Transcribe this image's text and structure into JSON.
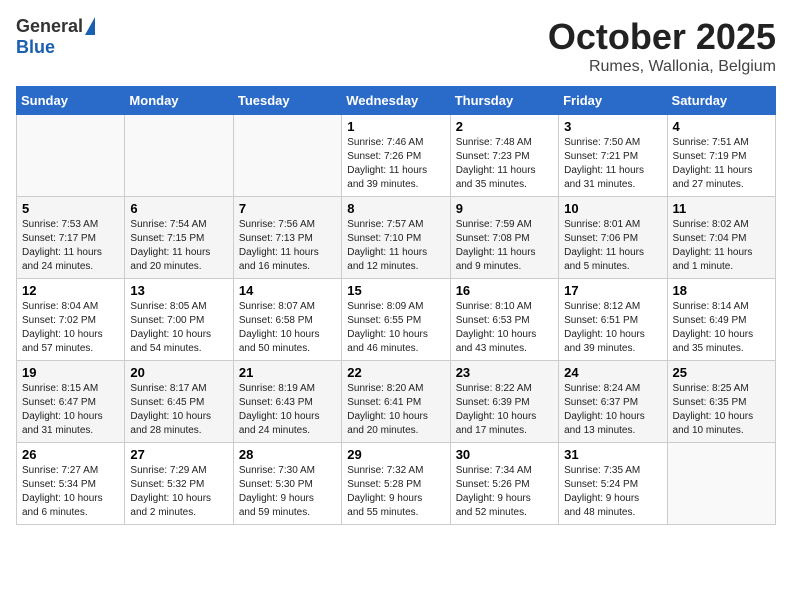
{
  "logo": {
    "general": "General",
    "blue": "Blue"
  },
  "title": "October 2025",
  "location": "Rumes, Wallonia, Belgium",
  "days_of_week": [
    "Sunday",
    "Monday",
    "Tuesday",
    "Wednesday",
    "Thursday",
    "Friday",
    "Saturday"
  ],
  "weeks": [
    [
      {
        "day": "",
        "content": ""
      },
      {
        "day": "",
        "content": ""
      },
      {
        "day": "",
        "content": ""
      },
      {
        "day": "1",
        "content": "Sunrise: 7:46 AM\nSunset: 7:26 PM\nDaylight: 11 hours\nand 39 minutes."
      },
      {
        "day": "2",
        "content": "Sunrise: 7:48 AM\nSunset: 7:23 PM\nDaylight: 11 hours\nand 35 minutes."
      },
      {
        "day": "3",
        "content": "Sunrise: 7:50 AM\nSunset: 7:21 PM\nDaylight: 11 hours\nand 31 minutes."
      },
      {
        "day": "4",
        "content": "Sunrise: 7:51 AM\nSunset: 7:19 PM\nDaylight: 11 hours\nand 27 minutes."
      }
    ],
    [
      {
        "day": "5",
        "content": "Sunrise: 7:53 AM\nSunset: 7:17 PM\nDaylight: 11 hours\nand 24 minutes."
      },
      {
        "day": "6",
        "content": "Sunrise: 7:54 AM\nSunset: 7:15 PM\nDaylight: 11 hours\nand 20 minutes."
      },
      {
        "day": "7",
        "content": "Sunrise: 7:56 AM\nSunset: 7:13 PM\nDaylight: 11 hours\nand 16 minutes."
      },
      {
        "day": "8",
        "content": "Sunrise: 7:57 AM\nSunset: 7:10 PM\nDaylight: 11 hours\nand 12 minutes."
      },
      {
        "day": "9",
        "content": "Sunrise: 7:59 AM\nSunset: 7:08 PM\nDaylight: 11 hours\nand 9 minutes."
      },
      {
        "day": "10",
        "content": "Sunrise: 8:01 AM\nSunset: 7:06 PM\nDaylight: 11 hours\nand 5 minutes."
      },
      {
        "day": "11",
        "content": "Sunrise: 8:02 AM\nSunset: 7:04 PM\nDaylight: 11 hours\nand 1 minute."
      }
    ],
    [
      {
        "day": "12",
        "content": "Sunrise: 8:04 AM\nSunset: 7:02 PM\nDaylight: 10 hours\nand 57 minutes."
      },
      {
        "day": "13",
        "content": "Sunrise: 8:05 AM\nSunset: 7:00 PM\nDaylight: 10 hours\nand 54 minutes."
      },
      {
        "day": "14",
        "content": "Sunrise: 8:07 AM\nSunset: 6:58 PM\nDaylight: 10 hours\nand 50 minutes."
      },
      {
        "day": "15",
        "content": "Sunrise: 8:09 AM\nSunset: 6:55 PM\nDaylight: 10 hours\nand 46 minutes."
      },
      {
        "day": "16",
        "content": "Sunrise: 8:10 AM\nSunset: 6:53 PM\nDaylight: 10 hours\nand 43 minutes."
      },
      {
        "day": "17",
        "content": "Sunrise: 8:12 AM\nSunset: 6:51 PM\nDaylight: 10 hours\nand 39 minutes."
      },
      {
        "day": "18",
        "content": "Sunrise: 8:14 AM\nSunset: 6:49 PM\nDaylight: 10 hours\nand 35 minutes."
      }
    ],
    [
      {
        "day": "19",
        "content": "Sunrise: 8:15 AM\nSunset: 6:47 PM\nDaylight: 10 hours\nand 31 minutes."
      },
      {
        "day": "20",
        "content": "Sunrise: 8:17 AM\nSunset: 6:45 PM\nDaylight: 10 hours\nand 28 minutes."
      },
      {
        "day": "21",
        "content": "Sunrise: 8:19 AM\nSunset: 6:43 PM\nDaylight: 10 hours\nand 24 minutes."
      },
      {
        "day": "22",
        "content": "Sunrise: 8:20 AM\nSunset: 6:41 PM\nDaylight: 10 hours\nand 20 minutes."
      },
      {
        "day": "23",
        "content": "Sunrise: 8:22 AM\nSunset: 6:39 PM\nDaylight: 10 hours\nand 17 minutes."
      },
      {
        "day": "24",
        "content": "Sunrise: 8:24 AM\nSunset: 6:37 PM\nDaylight: 10 hours\nand 13 minutes."
      },
      {
        "day": "25",
        "content": "Sunrise: 8:25 AM\nSunset: 6:35 PM\nDaylight: 10 hours\nand 10 minutes."
      }
    ],
    [
      {
        "day": "26",
        "content": "Sunrise: 7:27 AM\nSunset: 5:34 PM\nDaylight: 10 hours\nand 6 minutes."
      },
      {
        "day": "27",
        "content": "Sunrise: 7:29 AM\nSunset: 5:32 PM\nDaylight: 10 hours\nand 2 minutes."
      },
      {
        "day": "28",
        "content": "Sunrise: 7:30 AM\nSunset: 5:30 PM\nDaylight: 9 hours\nand 59 minutes."
      },
      {
        "day": "29",
        "content": "Sunrise: 7:32 AM\nSunset: 5:28 PM\nDaylight: 9 hours\nand 55 minutes."
      },
      {
        "day": "30",
        "content": "Sunrise: 7:34 AM\nSunset: 5:26 PM\nDaylight: 9 hours\nand 52 minutes."
      },
      {
        "day": "31",
        "content": "Sunrise: 7:35 AM\nSunset: 5:24 PM\nDaylight: 9 hours\nand 48 minutes."
      },
      {
        "day": "",
        "content": ""
      }
    ]
  ]
}
